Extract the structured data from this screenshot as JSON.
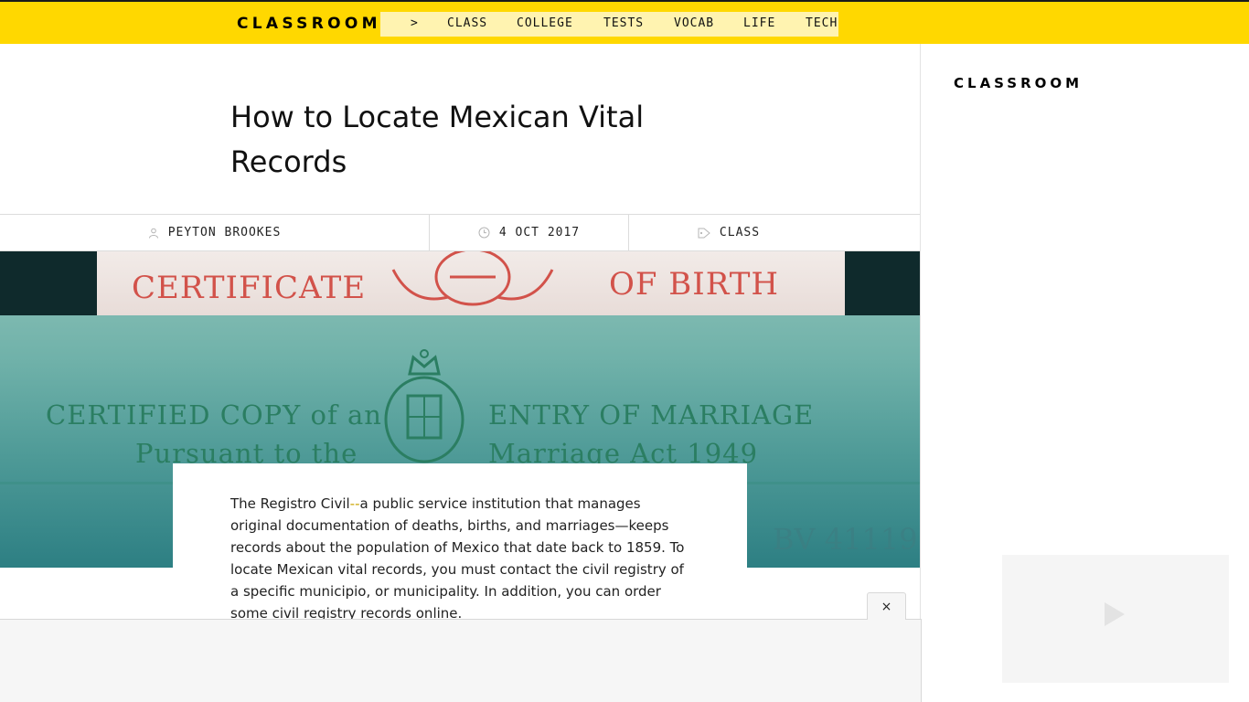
{
  "header": {
    "logo": "CLASSROOM",
    "nav": {
      "chevron": ">",
      "items": [
        "CLASS",
        "COLLEGE",
        "TESTS",
        "VOCAB",
        "LIFE",
        "TECH"
      ]
    }
  },
  "article": {
    "title": "How to Locate Mexican Vital Records",
    "meta": {
      "author": "PEYTON BROOKES",
      "date": "4 OCT 2017",
      "category": "CLASS"
    },
    "hero_image": {
      "top_left": "CERTIFICATE",
      "top_right": "OF BIRTH",
      "mid_left_1": "CERTIFIED COPY of an",
      "mid_left_2": "Pursuant to the",
      "mid_right_1": "ENTRY OF MARRIAGE",
      "mid_right_2": "Marriage Act 1949",
      "serial": "BV 41119"
    },
    "intro_lead": "The Registro Civil",
    "intro_dash": "--",
    "intro_rest": "a public service institution that manages original documentation of deaths, births, and marriages—keeps records about the population of Mexico that date back to 1859. To locate Mexican vital records, you must contact the civil registry of a specific municipio, or municipality. In addition, you can order some civil registry records online."
  },
  "sidebar": {
    "logo": "CLASSROOM"
  },
  "ad": {
    "close_label": "×"
  },
  "colors": {
    "brand_yellow": "#ffd800",
    "nav_bg": "#fff3b0",
    "accent_dash": "#c9a400"
  },
  "icons": {
    "author": "person-icon",
    "date": "clock-icon",
    "category": "tag-icon",
    "video": "play-icon"
  }
}
